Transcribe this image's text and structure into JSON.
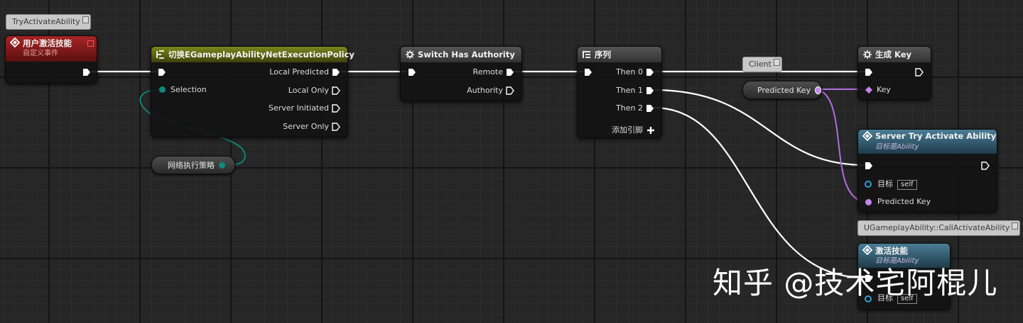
{
  "comments": {
    "event": "TryActivateAbility",
    "client": "Client",
    "call": "UGameplayAbility::CallActivateAbility"
  },
  "event_node": {
    "title": "用户激活技能",
    "subtitle": "自定义事件"
  },
  "switch_node": {
    "title": "切换EGameplayAbilityNetExecutionPolicy",
    "input_label": "Selection",
    "outputs": [
      "Local Predicted",
      "Local Only",
      "Server Initiated",
      "Server Only"
    ]
  },
  "policy_var": {
    "label": "网络执行策略"
  },
  "authority_node": {
    "title": "Switch Has Authority",
    "outputs": [
      "Remote",
      "Authority"
    ]
  },
  "sequence_node": {
    "title": "序列",
    "outputs": [
      "Then 0",
      "Then 1",
      "Then 2"
    ],
    "add_pin": "添加引脚"
  },
  "predicted_var": {
    "label": "Predicted Key"
  },
  "gen_key_node": {
    "title": "生成 Key",
    "input_label": "Key"
  },
  "server_node": {
    "title": "Server Try Activate Ability",
    "subtitle": "目标是Ability",
    "target_label": "目标",
    "target_value": "self",
    "key_label": "Predicted Key"
  },
  "activate_node": {
    "title": "激活技能",
    "subtitle": "目标是Ability",
    "target_label": "目标",
    "target_value": "self"
  },
  "watermark": "知乎 @技术宅阿棍儿",
  "colors": {
    "event_header": "#8e1b1b",
    "switch_header": "#5f6a12",
    "func_header": "#3f6e85",
    "macro_header": "#4a4a4a",
    "exec_wire": "#ffffff",
    "struct_pin": "#b06de0",
    "enum_pin": "#0e8a7c",
    "object_pin": "#2aa1d4"
  }
}
